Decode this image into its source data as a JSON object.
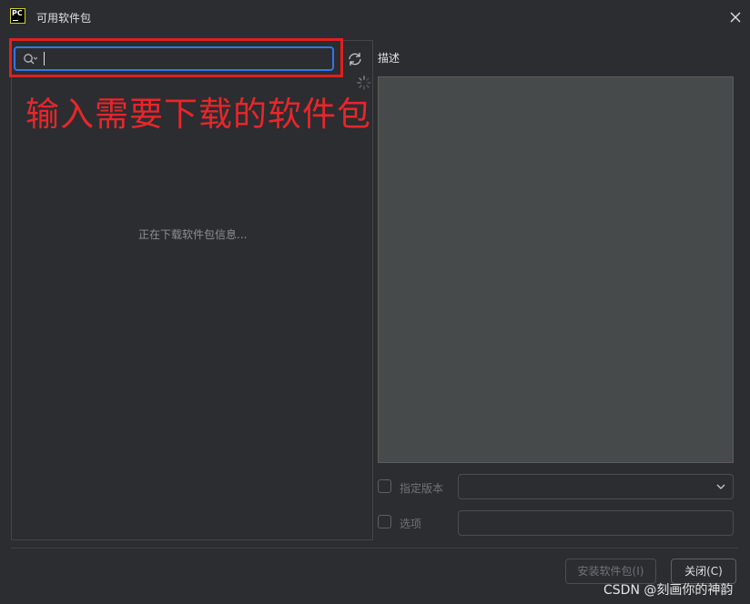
{
  "window": {
    "title": "可用软件包",
    "app_icon_text": "PC"
  },
  "search": {
    "value": "",
    "placeholder": ""
  },
  "annotation": "输入需要下载的软件包",
  "list": {
    "loading_text": "正在下载软件包信息..."
  },
  "description": {
    "label": "描述"
  },
  "options": {
    "specify_version_label": "指定版本",
    "specify_version_checked": false,
    "version_value": "",
    "options_label": "选项",
    "options_checked": false,
    "options_value": ""
  },
  "buttons": {
    "install_label": "安装软件包(I)",
    "close_label": "关闭(C)"
  },
  "watermark": "CSDN @刻画你的神韵",
  "colors": {
    "background": "#2b2d30",
    "focus_border": "#3574f0",
    "annotation_red": "#e8262a",
    "description_bg": "#464a4a"
  }
}
